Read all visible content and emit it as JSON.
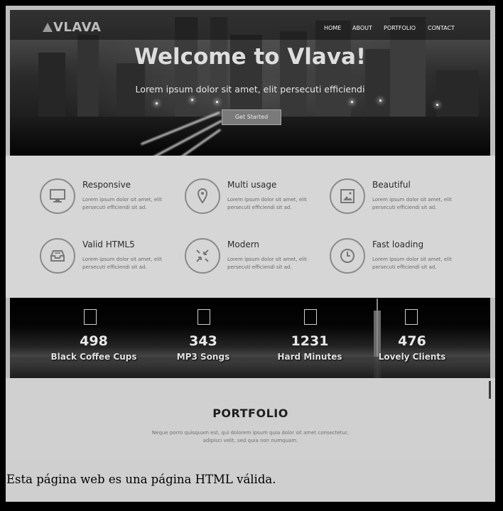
{
  "hero": {
    "logo": "VLAVA",
    "nav": [
      "HOME",
      "ABOUT",
      "PORTFOLIO",
      "CONTACT"
    ],
    "title": "Welcome to Vlava!",
    "subtitle": "Lorem ipsum dolor sit amet, elit persecuti efficiendi",
    "cta_label": "Get Started"
  },
  "features": [
    {
      "title": "Responsive",
      "text": "Lorem ipsum dolor sit amet, elit persecuti efficiendi sit ad.",
      "icon": "monitor-icon"
    },
    {
      "title": "Multi usage",
      "text": "Lorem ipsum dolor sit amet, elit persecuti efficiendi sit ad.",
      "icon": "map-pin-icon"
    },
    {
      "title": "Beautiful",
      "text": "Lorem ipsum dolor sit amet, elit persecuti efficiendi sit ad.",
      "icon": "picture-icon"
    },
    {
      "title": "Valid HTML5",
      "text": "Lorem ipsum dolor sit amet, elit persecuti efficiendi sit ad.",
      "icon": "inbox-icon"
    },
    {
      "title": "Modern",
      "text": "Lorem ipsum dolor sit amet, elit persecuti efficiendi sit ad.",
      "icon": "compress-icon"
    },
    {
      "title": "Fast loading",
      "text": "Lorem ipsum dolor sit amet, elit persecuti efficiendi sit ad.",
      "icon": "clock-icon"
    }
  ],
  "counters": [
    {
      "value": "498",
      "label": "Black Coffee Cups"
    },
    {
      "value": "343",
      "label": "MP3 Songs"
    },
    {
      "value": "1231",
      "label": "Hard Minutes"
    },
    {
      "value": "476",
      "label": "Lovely Clients"
    }
  ],
  "portfolio": {
    "title": "PORTFOLIO",
    "text": "Neque porro quisquam est, qui dolorem ipsum quia dolor sit amet consectetur, adipisci velit, sed quia non numquam."
  },
  "footer_text": "Esta página web es una página HTML válida."
}
